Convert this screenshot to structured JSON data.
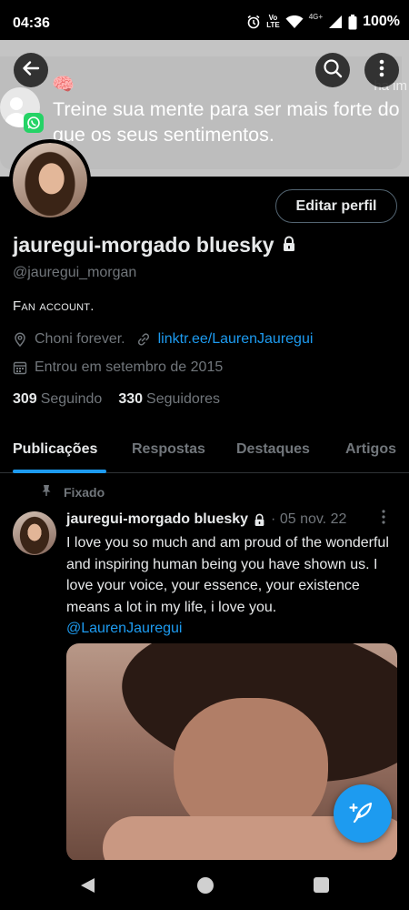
{
  "status_bar": {
    "time": "04:36",
    "volte_top": "Vo",
    "volte_bottom": "LTE",
    "network": "4G+",
    "battery": "100%",
    "icons": [
      "alarm-icon",
      "volte-icon",
      "wifi-icon",
      "signal-icon",
      "battery-icon"
    ]
  },
  "banner": {
    "text": "Treine sua mente para ser mais forte do que os seus sentimentos.",
    "ha_text": "ha im",
    "emoji": "🧠"
  },
  "header_buttons": {
    "back_icon": "arrow-left-icon",
    "search_icon": "search-icon",
    "more_icon": "more-vertical-icon"
  },
  "profile": {
    "edit_button": "Editar perfil",
    "display_name": "jauregui-morgado bluesky",
    "handle": "@jauregui_morgan",
    "bio": "Fan account.",
    "location": "Choni forever.",
    "link": "linktr.ee/LaurenJauregui",
    "joined": "Entrou em setembro de 2015",
    "following_count": "309",
    "following_label": "Seguindo",
    "followers_count": "330",
    "followers_label": "Seguidores"
  },
  "tabs": [
    {
      "label": "Publicações",
      "active": true
    },
    {
      "label": "Respostas",
      "active": false
    },
    {
      "label": "Destaques",
      "active": false
    },
    {
      "label": "Artigos",
      "active": false
    }
  ],
  "post": {
    "pinned_label": "Fixado",
    "author": "jauregui-morgado bluesky",
    "date": "· 05 nov. 22",
    "text": "I love you so much and am proud of the wonderful and inspiring human being you have shown us. I love your voice, your essence, your existence means a lot in my life, i love you.",
    "mention": "@LaurenJauregui"
  },
  "colors": {
    "accent": "#1d9bf0",
    "secondary_text": "#71767b",
    "primary_text": "#e7e9ea",
    "background": "#000000",
    "whatsapp": "#25d366"
  }
}
